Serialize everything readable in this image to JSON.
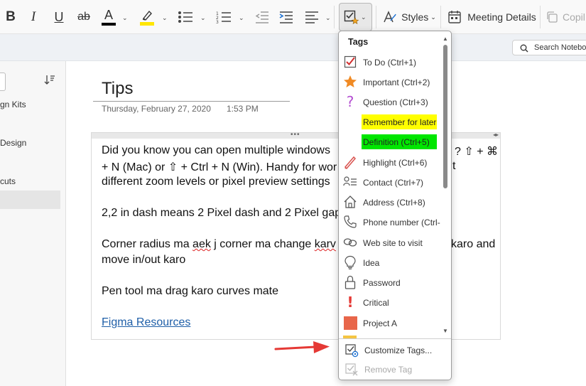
{
  "ribbon": {
    "bold": "B",
    "italic": "I",
    "underline": "U",
    "strikethrough": "ab",
    "font_color_letter": "A",
    "font_color": "#000000",
    "highlight_color": "#ffe600",
    "styles_label": "Styles",
    "meeting_details_label": "Meeting Details",
    "copilot_label": "Copil"
  },
  "search": {
    "placeholder": "Search Notebook"
  },
  "sidebar": {
    "items": [
      "gn Kits",
      "Design",
      "cuts"
    ]
  },
  "page": {
    "title": "Tips",
    "date": "Thursday, February 27, 2020",
    "time": "1:53 PM",
    "lines": [
      "Did you know you can open multiple windows",
      "+ N (Mac) or ⇧ + Ctrl + N (Win). Handy for wor",
      "different zoom levels or pixel preview settings",
      "2,2 in dash means 2 Pixel dash and 2 Pixel gap",
      "Corner radius ma aek j corner ma change karv",
      "move in/out karo",
      "Pen tool ma drag karo curves mate"
    ],
    "line1_tail": "? ⇧ + ⌘",
    "line3_tail": "t",
    "line5_mid": "karo and",
    "link": "Figma Resources"
  },
  "tags_menu": {
    "header": "Tags",
    "items": [
      {
        "label": "To Do (Ctrl+1)",
        "icon": "checkbox-icon"
      },
      {
        "label": "Important (Ctrl+2)",
        "icon": "star-icon"
      },
      {
        "label": "Question (Ctrl+3)",
        "icon": "question-icon"
      },
      {
        "label": "Remember for later",
        "icon": "",
        "highlight": "#ffff00"
      },
      {
        "label": "Definition (Ctrl+5)",
        "icon": "",
        "highlight": "#00e600"
      },
      {
        "label": "Highlight (Ctrl+6)",
        "icon": "pen-icon"
      },
      {
        "label": "Contact (Ctrl+7)",
        "icon": "contact-icon"
      },
      {
        "label": "Address (Ctrl+8)",
        "icon": "home-icon"
      },
      {
        "label": "Phone number (Ctrl-",
        "icon": "phone-icon"
      },
      {
        "label": "Web site to visit",
        "icon": "link-icon"
      },
      {
        "label": "Idea",
        "icon": "lightbulb-icon"
      },
      {
        "label": "Password",
        "icon": "lock-icon"
      },
      {
        "label": "Critical",
        "icon": "exclamation-icon"
      },
      {
        "label": "Project A",
        "icon": "project-square-icon",
        "color": "#e8664a"
      }
    ],
    "customize_label": "Customize Tags...",
    "remove_label": "Remove Tag"
  }
}
